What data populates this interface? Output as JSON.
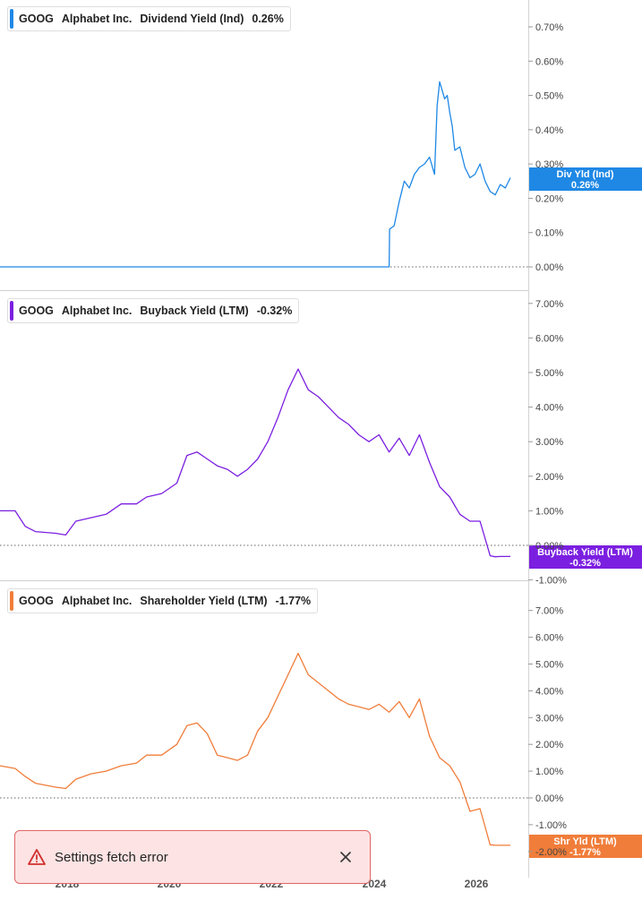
{
  "colors": {
    "dividend": "#1f88e5",
    "buyback": "#7b1fe0",
    "shareholder": "#f07d3a",
    "toast_bg": "#fde3e3",
    "toast_border": "#e06666",
    "warning": "#d32f2f"
  },
  "x_axis": {
    "labels": [
      "2018",
      "2020",
      "2022",
      "2024",
      "2026"
    ]
  },
  "toast": {
    "message": "Settings fetch error",
    "icon": "warning-icon",
    "close_icon": "close-icon"
  },
  "chart_data": [
    {
      "type": "line",
      "ticker": "GOOG",
      "company": "Alphabet Inc.",
      "metric": "Dividend Yield (Ind)",
      "current": "0.26%",
      "badge": {
        "label": "Div Yld (Ind)",
        "value": "0.26%"
      },
      "ytick_labels": [
        "0.00%",
        "0.10%",
        "0.20%",
        "0.30%",
        "0.40%",
        "0.50%",
        "0.60%",
        "0.70%"
      ],
      "ylim": [
        0,
        0.7
      ],
      "reference_line": 0,
      "x": [
        2016.5,
        2024.2,
        2024.21,
        2024.3,
        2024.4,
        2024.5,
        2024.6,
        2024.7,
        2024.8,
        2024.9,
        2025.0,
        2025.1,
        2025.15,
        2025.2,
        2025.3,
        2025.35,
        2025.4,
        2025.45,
        2025.5,
        2025.6,
        2025.7,
        2025.8,
        2025.9,
        2026.0,
        2026.1,
        2026.2,
        2026.3,
        2026.4,
        2026.5,
        2026.6
      ],
      "values": [
        0,
        0,
        0.11,
        0.12,
        0.19,
        0.25,
        0.23,
        0.27,
        0.29,
        0.3,
        0.32,
        0.27,
        0.47,
        0.54,
        0.49,
        0.5,
        0.45,
        0.41,
        0.34,
        0.35,
        0.29,
        0.26,
        0.27,
        0.3,
        0.25,
        0.22,
        0.21,
        0.24,
        0.23,
        0.26
      ]
    },
    {
      "type": "line",
      "ticker": "GOOG",
      "company": "Alphabet Inc.",
      "metric": "Buyback Yield (LTM)",
      "current": "-0.32%",
      "badge": {
        "label": "Buyback Yield (LTM)",
        "value": "-0.32%"
      },
      "ytick_labels": [
        "-1.00%",
        "0.00%",
        "1.00%",
        "2.00%",
        "3.00%",
        "4.00%",
        "5.00%",
        "6.00%",
        "7.00%"
      ],
      "ylim": [
        -1,
        7
      ],
      "reference_line": 0,
      "x": [
        2016.5,
        2016.8,
        2017.0,
        2017.2,
        2017.6,
        2017.8,
        2018.0,
        2018.3,
        2018.6,
        2018.9,
        2019.2,
        2019.4,
        2019.7,
        2020.0,
        2020.2,
        2020.4,
        2020.6,
        2020.8,
        2021.0,
        2021.2,
        2021.4,
        2021.6,
        2021.8,
        2022.0,
        2022.2,
        2022.4,
        2022.6,
        2022.8,
        2023.0,
        2023.2,
        2023.4,
        2023.6,
        2023.8,
        2024.0,
        2024.2,
        2024.4,
        2024.6,
        2024.8,
        2025.0,
        2025.2,
        2025.4,
        2025.6,
        2025.8,
        2026.0,
        2026.2,
        2026.3,
        2026.4,
        2026.5,
        2026.6
      ],
      "values": [
        1.0,
        1.0,
        0.55,
        0.4,
        0.35,
        0.3,
        0.7,
        0.8,
        0.9,
        1.2,
        1.2,
        1.4,
        1.5,
        1.8,
        2.6,
        2.7,
        2.5,
        2.3,
        2.2,
        2.0,
        2.2,
        2.5,
        3.0,
        3.7,
        4.5,
        5.1,
        4.5,
        4.3,
        4.0,
        3.7,
        3.5,
        3.2,
        3.0,
        3.2,
        2.7,
        3.1,
        2.6,
        3.2,
        2.4,
        1.7,
        1.4,
        0.9,
        0.7,
        0.7,
        -0.3,
        -0.33,
        -0.32,
        -0.32,
        -0.32
      ]
    },
    {
      "type": "line",
      "ticker": "GOOG",
      "company": "Alphabet Inc.",
      "metric": "Shareholder Yield (LTM)",
      "current": "-1.77%",
      "badge": {
        "label": "Shr Yld (LTM)",
        "value": "-1.77%"
      },
      "ytick_labels": [
        "-2.00%",
        "-1.00%",
        "0.00%",
        "1.00%",
        "2.00%",
        "3.00%",
        "4.00%",
        "5.00%",
        "6.00%",
        "7.00%"
      ],
      "ylim": [
        -2.2,
        7.3
      ],
      "reference_line": 0,
      "x": [
        2016.5,
        2016.8,
        2017.0,
        2017.2,
        2017.6,
        2017.8,
        2018.0,
        2018.3,
        2018.6,
        2018.9,
        2019.2,
        2019.4,
        2019.7,
        2020.0,
        2020.2,
        2020.4,
        2020.6,
        2020.8,
        2021.0,
        2021.2,
        2021.4,
        2021.6,
        2021.8,
        2022.0,
        2022.2,
        2022.4,
        2022.6,
        2022.8,
        2023.0,
        2023.2,
        2023.4,
        2023.6,
        2023.8,
        2024.0,
        2024.2,
        2024.4,
        2024.6,
        2024.8,
        2025.0,
        2025.2,
        2025.4,
        2025.6,
        2025.8,
        2026.0,
        2026.2,
        2026.3,
        2026.4,
        2026.5,
        2026.6
      ],
      "values": [
        1.2,
        1.1,
        0.8,
        0.55,
        0.4,
        0.35,
        0.7,
        0.9,
        1.0,
        1.2,
        1.3,
        1.6,
        1.6,
        2.0,
        2.7,
        2.8,
        2.4,
        1.6,
        1.5,
        1.4,
        1.6,
        2.5,
        3.0,
        3.8,
        4.6,
        5.4,
        4.6,
        4.3,
        4.0,
        3.7,
        3.5,
        3.4,
        3.3,
        3.5,
        3.2,
        3.6,
        3.0,
        3.7,
        2.3,
        1.5,
        1.2,
        0.6,
        -0.5,
        -0.4,
        -1.75,
        -1.77,
        -1.77,
        -1.77,
        -1.77
      ]
    }
  ]
}
